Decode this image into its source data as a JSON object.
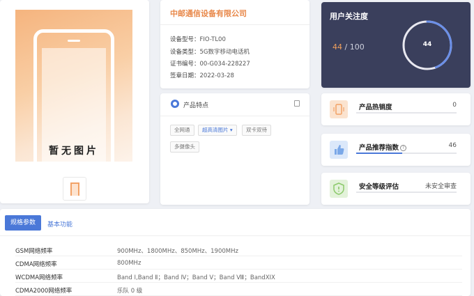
{
  "product_image": {
    "placeholder_text": "暂无图片"
  },
  "company": {
    "name": "中邮通信设备有限公司",
    "rows": [
      {
        "label": "设备型号：",
        "value": "FIO-TL00"
      },
      {
        "label": "设备类型：",
        "value": "5G数字移动电话机"
      },
      {
        "label": "证书编号：",
        "value": "00-G034-228227"
      },
      {
        "label": "签章日期：",
        "value": "2022-03-28"
      }
    ]
  },
  "features": {
    "title": "产品特点",
    "tags": [
      "全网通",
      "超高清图片",
      "双卡双待",
      "多摄像头"
    ]
  },
  "attention": {
    "title": "用户关注度",
    "value": "44",
    "slash": "/",
    "max": "100",
    "fraction": 0.44,
    "colors": {
      "ring_base": "#e8e8f0",
      "ring_fill": "#6b8fe8"
    }
  },
  "metrics": [
    {
      "label": "产品热销度",
      "value": "0",
      "fraction": 0.0,
      "icon": "phone-vibrate-icon",
      "icon_color": "#f2a266"
    },
    {
      "label": "产品推荐指数",
      "value": "46",
      "fraction": 0.46,
      "icon": "thumbs-up-icon",
      "icon_color": "#7aa8e8",
      "has_info": true,
      "info_glyph": "?"
    },
    {
      "label": "安全等级评估",
      "value": "未安全审查",
      "fraction": 0.0,
      "icon": "shield-alert-icon",
      "icon_color": "#8bc96a"
    }
  ],
  "spec": {
    "tabs": [
      "规格参数",
      "基本功能"
    ],
    "active_tab": "规格参数",
    "rows": [
      {
        "key": "GSM网络频率",
        "value": "900MHz、1800MHz、850MHz、1900MHz"
      },
      {
        "key": "CDMA网络频率",
        "value": "800MHz"
      },
      {
        "key": "WCDMA网络频率",
        "value": "Band Ⅰ,Band Ⅱ；Band Ⅳ；Band Ⅴ；Band Ⅷ；BandXIX"
      },
      {
        "key": "CDMA2000网络频率",
        "value": "乐队 0 级"
      }
    ]
  }
}
